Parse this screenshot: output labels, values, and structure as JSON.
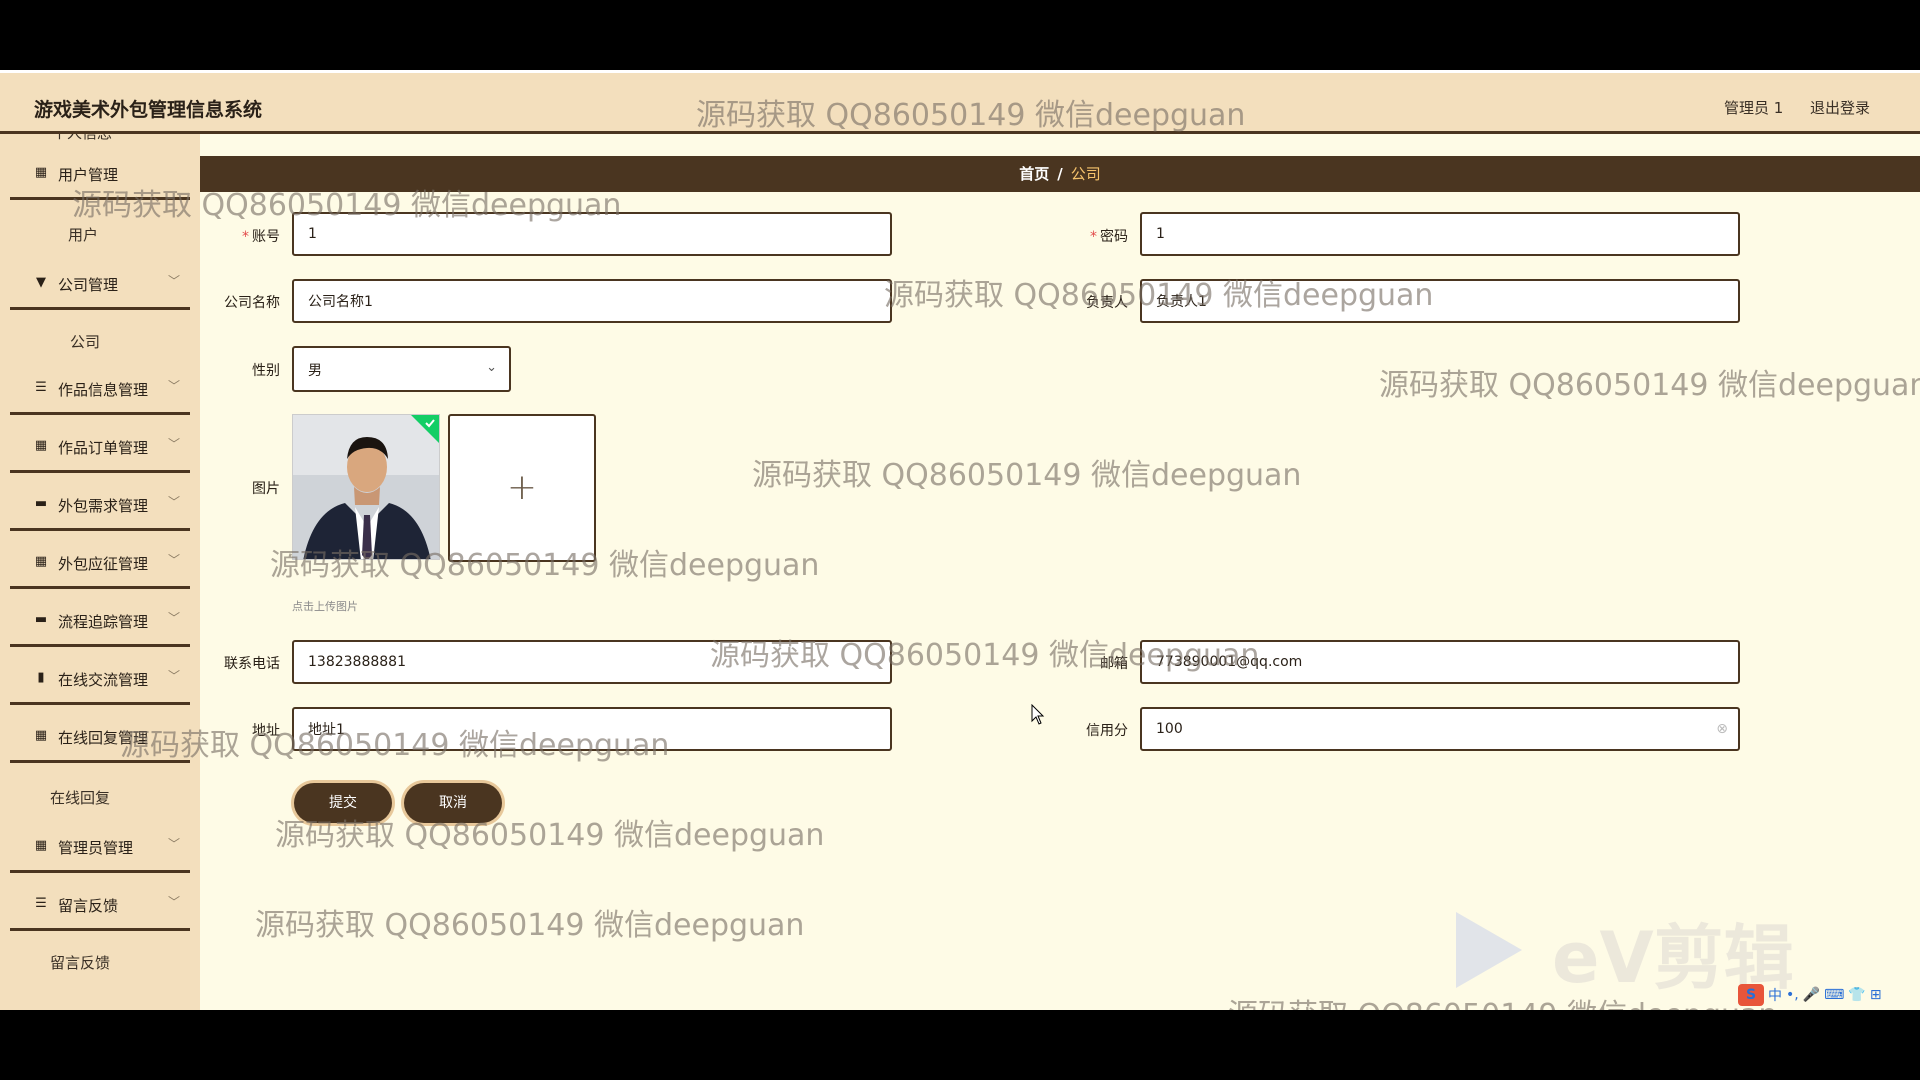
{
  "header": {
    "app_title": "游戏美术外包管理信息系统",
    "user": "管理员 1",
    "logout": "退出登录"
  },
  "sidebar": {
    "partial_top": "个人信息",
    "items": [
      {
        "label": "用户管理",
        "icon": "grid-icon"
      },
      {
        "label": "用户",
        "sub": true
      },
      {
        "label": "公司管理",
        "icon": "flag-icon"
      },
      {
        "label": "公司",
        "sub": true
      },
      {
        "label": "作品信息管理",
        "icon": "list-icon"
      },
      {
        "label": "作品订单管理",
        "icon": "grid-icon"
      },
      {
        "label": "外包需求管理",
        "icon": "monitor-icon"
      },
      {
        "label": "外包应征管理",
        "icon": "grid-icon"
      },
      {
        "label": "流程追踪管理",
        "icon": "monitor-icon"
      },
      {
        "label": "在线交流管理",
        "icon": "chart-icon"
      },
      {
        "label": "在线回复管理",
        "icon": "grid-icon"
      },
      {
        "label": "在线回复",
        "sub": true
      },
      {
        "label": "管理员管理",
        "icon": "grid-icon"
      },
      {
        "label": "留言反馈",
        "icon": "list-icon"
      },
      {
        "label": "留言反馈",
        "sub": true
      }
    ]
  },
  "breadcrumb": {
    "home": "首页",
    "separator": "/",
    "current": "公司"
  },
  "form": {
    "account": {
      "label": "账号",
      "value": "1"
    },
    "password": {
      "label": "密码",
      "value": "1"
    },
    "company_name": {
      "label": "公司名称",
      "value": "公司名称1"
    },
    "manager": {
      "label": "负责人",
      "value": "负责人1"
    },
    "gender": {
      "label": "性别",
      "value": "男"
    },
    "image": {
      "label": "图片",
      "upload_hint": "点击上传图片",
      "plus": "+"
    },
    "phone": {
      "label": "联系电话",
      "value": "13823888881"
    },
    "email": {
      "label": "邮箱",
      "value": "773890001@qq.com"
    },
    "address": {
      "label": "地址",
      "value": "地址1"
    },
    "credit": {
      "label": "信用分",
      "value": "100"
    },
    "submit": "提交",
    "cancel": "取消"
  },
  "watermark": "源码获取 QQ86050149 微信deepguan",
  "ev_logo": "eV剪辑",
  "ime": {
    "s": "S",
    "items": [
      "中",
      "•,",
      "🎤",
      "⌨",
      "👕",
      "⊞"
    ]
  },
  "colors": {
    "accent": "#4a3520",
    "header_bg": "#f3dfbd",
    "page_bg": "#fefbe6",
    "breadcrumb_current": "#f5c26b"
  }
}
